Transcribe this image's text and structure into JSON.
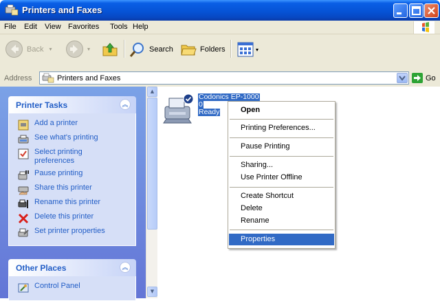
{
  "window": {
    "title": "Printers and Faxes"
  },
  "menubar": {
    "items": [
      "File",
      "Edit",
      "View",
      "Favorites",
      "Tools",
      "Help"
    ]
  },
  "toolbar": {
    "back_label": "Back",
    "search_label": "Search",
    "folders_label": "Folders"
  },
  "address": {
    "label": "Address",
    "value": "Printers and Faxes",
    "go_label": "Go"
  },
  "printer_tasks": {
    "title": "Printer Tasks",
    "items": [
      {
        "label": "Add a printer",
        "icon": "add-printer-icon"
      },
      {
        "label": "See what's printing",
        "icon": "print-queue-icon"
      },
      {
        "label": "Select printing preferences",
        "icon": "preferences-icon"
      },
      {
        "label": "Pause printing",
        "icon": "pause-printer-icon"
      },
      {
        "label": "Share this printer",
        "icon": "share-printer-icon"
      },
      {
        "label": "Rename this printer",
        "icon": "rename-printer-icon"
      },
      {
        "label": "Delete this printer",
        "icon": "delete-icon"
      },
      {
        "label": "Set printer properties",
        "icon": "printer-properties-icon"
      }
    ]
  },
  "other_places": {
    "title": "Other Places",
    "items": [
      {
        "label": "Control Panel",
        "icon": "control-panel-icon"
      }
    ]
  },
  "printer_item": {
    "name": "Codonics EP-1000",
    "documents": "0",
    "status": "Ready"
  },
  "context_menu": {
    "items": [
      "Open",
      "Printing Preferences...",
      "Pause Printing",
      "Sharing...",
      "Use Printer Offline",
      "Create Shortcut",
      "Delete",
      "Rename",
      "Properties"
    ]
  },
  "colors": {
    "titlebar_blue": "#0653d6",
    "task_link_blue": "#215dc6",
    "selection_blue": "#316ac5",
    "pane_blue": "#7ba2e7",
    "delete_red": "#d91e18"
  }
}
